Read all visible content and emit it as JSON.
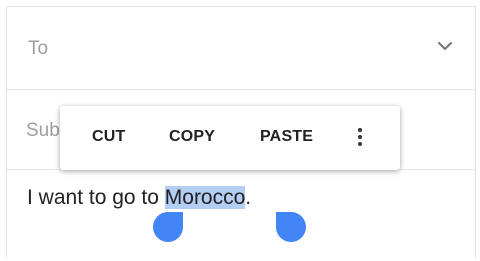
{
  "compose": {
    "to_label": "To",
    "subject_label": "Sub",
    "body_before": "I want to go to ",
    "body_selected": "Morocco",
    "body_after": "."
  },
  "context_menu": {
    "cut_label": "CUT",
    "copy_label": "COPY",
    "paste_label": "PASTE",
    "more_icon": "more-vert-icon"
  },
  "colors": {
    "selection_highlight": "#b3cdf3",
    "selection_handle": "#4285f4"
  }
}
